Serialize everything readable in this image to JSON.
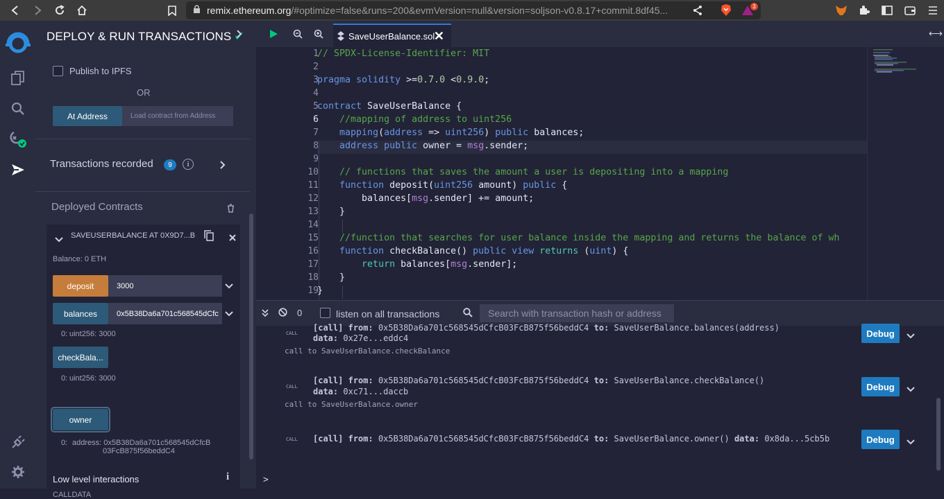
{
  "browser": {
    "url_host": "remix.ethereum.org",
    "url_rest": "/#optimize=false&runs=200&evmVersion=null&version=soljson-v0.8.17+commit.8df45...",
    "brave_badge": "3"
  },
  "panel": {
    "title": "DEPLOY & RUN TRANSACTIONS",
    "publish_label": "Publish to IPFS",
    "or_label": "OR",
    "at_address_label": "At Address",
    "load_placeholder": "Load contract from Address",
    "transactions_recorded_label": "Transactions recorded",
    "transactions_count": "9",
    "deployed_contracts_label": "Deployed Contracts",
    "contract": {
      "title": "SAVEUSERBALANCE AT 0X9D7...B",
      "balance": "Balance: 0 ETH",
      "deposit_label": "deposit",
      "deposit_value": "3000",
      "balances_label": "balances",
      "balances_value": "0x5B38Da6a701c568545dCfc",
      "balances_result_index": "0:",
      "balances_result": "uint256: 3000",
      "checkbalance_label": "checkBala...",
      "checkbalance_result_index": "0:",
      "checkbalance_result": "uint256: 3000",
      "owner_label": "owner",
      "owner_result_index": "0:",
      "owner_result_line1": "address: 0x5B38Da6a701c568545dCfcB",
      "owner_result_line2": "03FcB875f56beddC4",
      "low_level_label": "Low level interactions",
      "calldata_label": "CALLDATA"
    }
  },
  "editor": {
    "tab_name": "SaveUserBalance.sol",
    "line_numbers": [
      "1",
      "2",
      "3",
      "4",
      "5",
      "6",
      "7",
      "8",
      "9",
      "10",
      "11",
      "12",
      "13",
      "14",
      "15",
      "16",
      "17",
      "18",
      "19"
    ],
    "active_line": "6"
  },
  "terminal": {
    "count": "0",
    "listen_label": "listen on all transactions",
    "search_placeholder": "Search with transaction hash or address",
    "call_badge": "CALL",
    "entries": [
      {
        "tag": "[call]",
        "from_label": "from:",
        "from": "0x5B38Da6a701c568545dCfcB03FcB875f56beddC4",
        "to_label": "to:",
        "to": "SaveUserBalance.balances(address)",
        "data_label": "data:",
        "data": "0x27e...eddc4",
        "note": "call to SaveUserBalance.checkBalance"
      },
      {
        "tag": "[call]",
        "from_label": "from:",
        "from": "0x5B38Da6a701c568545dCfcB03FcB875f56beddC4",
        "to_label": "to:",
        "to": "SaveUserBalance.checkBalance()",
        "data_label": "data:",
        "data": "0xc71...daccb",
        "note": "call to SaveUserBalance.owner"
      },
      {
        "tag": "[call]",
        "from_label": "from:",
        "from": "0x5B38Da6a701c568545dCfcB03FcB875f56beddC4",
        "to_label": "to:",
        "to": "SaveUserBalance.owner()",
        "data_label": "data:",
        "data": "0x8da...5cb5b"
      }
    ],
    "debug_label": "Debug",
    "prompt": ">"
  },
  "colors": {
    "accent_blue": "#1f7bbf",
    "button_blue": "#2d5a78",
    "button_orange": "#c67d3b",
    "success_green": "#00c880"
  }
}
